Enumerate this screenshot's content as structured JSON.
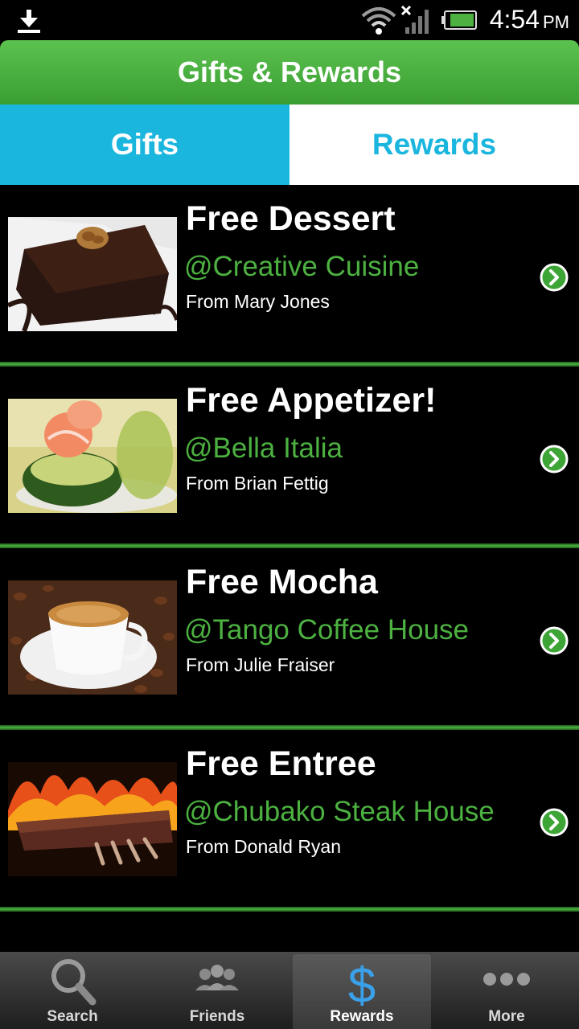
{
  "status_bar": {
    "time": "4:54",
    "ampm": "PM",
    "icons": [
      "download-icon",
      "wifi-icon",
      "signal-icon",
      "battery-icon"
    ]
  },
  "header": {
    "title": "Gifts & Rewards"
  },
  "tabs": [
    {
      "label": "Gifts",
      "active": true
    },
    {
      "label": "Rewards",
      "active": false
    }
  ],
  "gifts": [
    {
      "title": "Free Dessert",
      "place": "@Creative Cuisine",
      "from": "From Mary Jones",
      "image": "chocolate-brownie"
    },
    {
      "title": "Free Appetizer!",
      "place": "@Bella Italia",
      "from": "From Brian Fettig",
      "image": "shrimp-avocado"
    },
    {
      "title": "Free Mocha",
      "place": "@Tango Coffee House",
      "from": "From Julie Fraiser",
      "image": "coffee-cup"
    },
    {
      "title": "Free Entree",
      "place": "@Chubako Steak House",
      "from": "From Donald Ryan",
      "image": "grilled-ribs"
    }
  ],
  "bottom_nav": [
    {
      "label": "Search",
      "icon": "search-icon",
      "active": false
    },
    {
      "label": "Friends",
      "icon": "friends-icon",
      "active": false
    },
    {
      "label": "Rewards",
      "icon": "dollar-icon",
      "active": true
    },
    {
      "label": "More",
      "icon": "more-icon",
      "active": false
    }
  ],
  "colors": {
    "header_green": "#4cb140",
    "tab_blue": "#1ab6de",
    "place_green": "#4cb140",
    "dollar_blue": "#3aa0e8"
  }
}
